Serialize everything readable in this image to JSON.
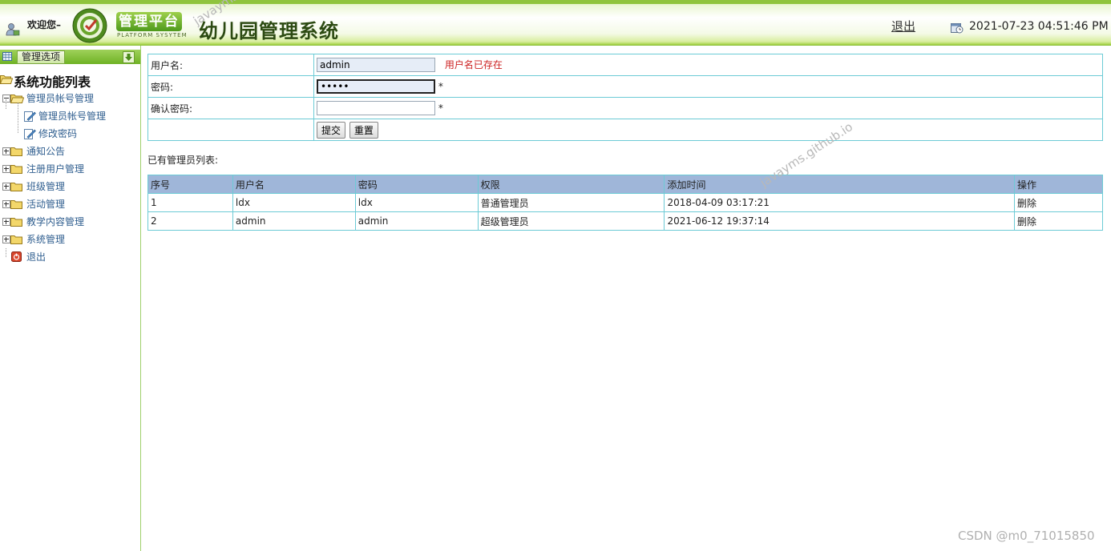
{
  "header": {
    "welcome": "欢迎您–",
    "badge_main": "管理平台",
    "badge_sub": "PLATFORM SYSYTEM",
    "title": "幼儿园管理系统",
    "logout": "退出",
    "datetime": "2021-07-23 04:51:46 PM"
  },
  "sidebar": {
    "header_label": "管理选项",
    "root": "系统功能列表",
    "items": [
      {
        "label": "管理员帐号管理",
        "expanded": true
      },
      {
        "label": "管理员帐号管理",
        "child": true
      },
      {
        "label": "修改密码",
        "child": true
      },
      {
        "label": "通知公告"
      },
      {
        "label": "注册用户管理"
      },
      {
        "label": "班级管理"
      },
      {
        "label": "活动管理"
      },
      {
        "label": "教学内容管理"
      },
      {
        "label": "系统管理"
      },
      {
        "label": "退出",
        "exit": true
      }
    ]
  },
  "form": {
    "username_label": "用户名:",
    "username_value": "admin",
    "username_error": "用户名已存在",
    "password_label": "密码:",
    "password_value": "•••••",
    "confirm_label": "确认密码:",
    "confirm_value": "",
    "required_mark": "*",
    "submit_label": "提交",
    "reset_label": "重置"
  },
  "list": {
    "caption": "已有管理员列表:",
    "columns": [
      "序号",
      "用户名",
      "密码",
      "权限",
      "添加时间",
      "操作"
    ],
    "rows": [
      [
        "1",
        "ldx",
        "ldx",
        "普通管理员",
        "2018-04-09 03:17:21",
        "删除"
      ],
      [
        "2",
        "admin",
        "admin",
        "超级管理员",
        "2021-06-12 19:37:14",
        "删除"
      ]
    ]
  },
  "watermarks": {
    "text": "javayms.github.io",
    "csdn": "CSDN @m0_71015850"
  }
}
